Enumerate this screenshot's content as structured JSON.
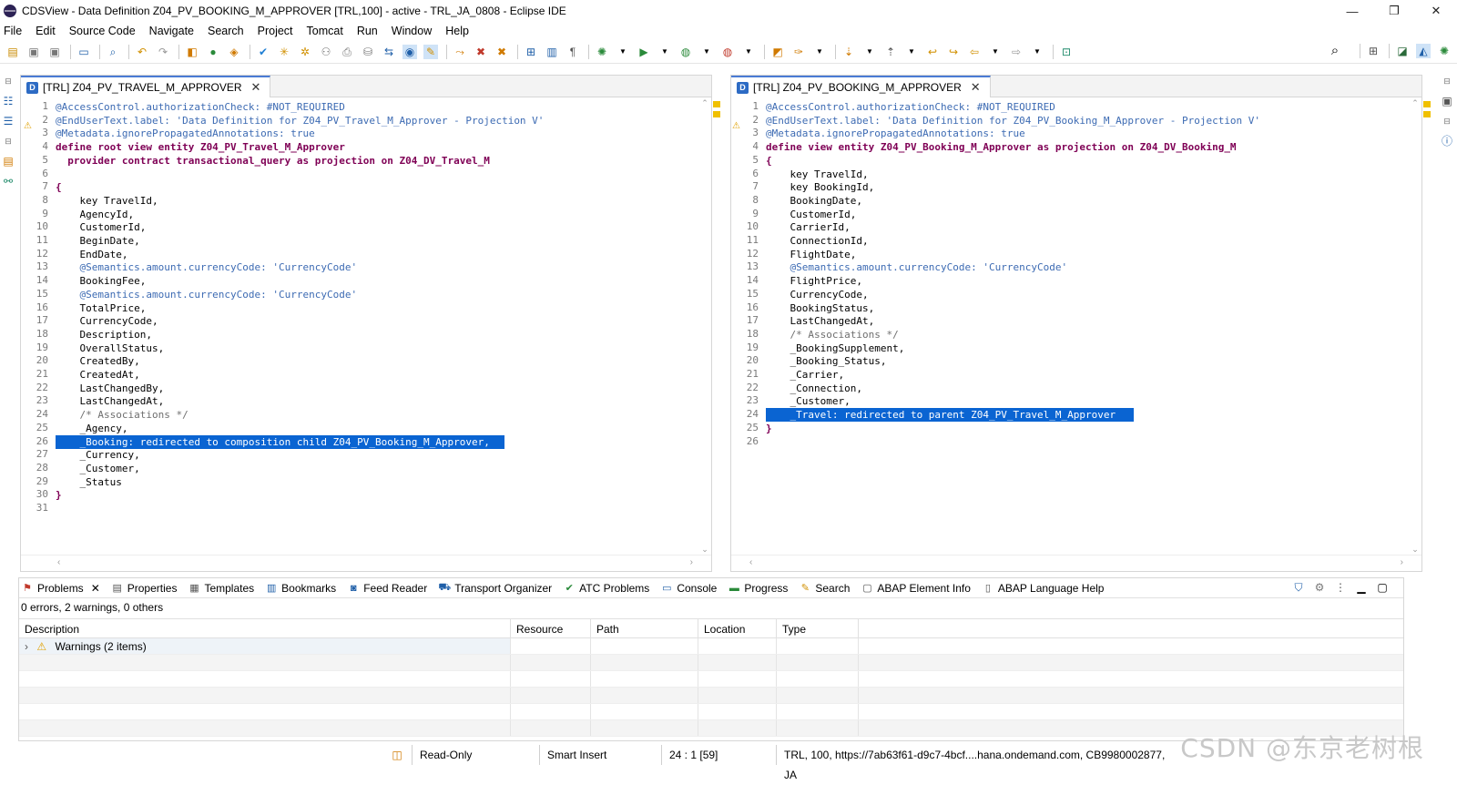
{
  "window": {
    "title": "CDSView - Data Definition Z04_PV_BOOKING_M_APPROVER [TRL,100] - active - TRL_JA_0808 - Eclipse IDE"
  },
  "menu": [
    "File",
    "Edit",
    "Source Code",
    "Navigate",
    "Search",
    "Project",
    "Tomcat",
    "Run",
    "Window",
    "Help"
  ],
  "left_editor": {
    "tab_label": "[TRL] Z04_PV_TRAVEL_M_APPROVER",
    "lines": [
      {
        "n": "1",
        "t": "@AccessControl.authorizationCheck: #NOT_REQUIRED",
        "k": "ann"
      },
      {
        "n": "2",
        "t": "@EndUserText.label: 'Data Definition for Z04_PV_Travel_M_Approver - Projection V'",
        "k": "ann"
      },
      {
        "n": "3",
        "t": "@Metadata.ignorePropagatedAnnotations: true",
        "k": "ann"
      },
      {
        "n": "4",
        "t": "define root view entity Z04_PV_Travel_M_Approver",
        "k": "kw"
      },
      {
        "n": "5",
        "t": "  provider contract transactional_query as projection on Z04_DV_Travel_M",
        "k": "kw"
      },
      {
        "n": "6",
        "t": "",
        "k": ""
      },
      {
        "n": "7",
        "t": "{",
        "k": "kw"
      },
      {
        "n": "8",
        "t": "    key TravelId,",
        "k": ""
      },
      {
        "n": "9",
        "t": "    AgencyId,",
        "k": ""
      },
      {
        "n": "10",
        "t": "    CustomerId,",
        "k": ""
      },
      {
        "n": "11",
        "t": "    BeginDate,",
        "k": ""
      },
      {
        "n": "12",
        "t": "    EndDate,",
        "k": ""
      },
      {
        "n": "13",
        "t": "    @Semantics.amount.currencyCode: 'CurrencyCode'",
        "k": "ann"
      },
      {
        "n": "14",
        "t": "    BookingFee,",
        "k": ""
      },
      {
        "n": "15",
        "t": "    @Semantics.amount.currencyCode: 'CurrencyCode'",
        "k": "ann"
      },
      {
        "n": "16",
        "t": "    TotalPrice,",
        "k": ""
      },
      {
        "n": "17",
        "t": "    CurrencyCode,",
        "k": ""
      },
      {
        "n": "18",
        "t": "    Description,",
        "k": ""
      },
      {
        "n": "19",
        "t": "    OverallStatus,",
        "k": ""
      },
      {
        "n": "20",
        "t": "    CreatedBy,",
        "k": ""
      },
      {
        "n": "21",
        "t": "    CreatedAt,",
        "k": ""
      },
      {
        "n": "22",
        "t": "    LastChangedBy,",
        "k": ""
      },
      {
        "n": "23",
        "t": "    LastChangedAt,",
        "k": ""
      },
      {
        "n": "24",
        "t": "    /* Associations */",
        "k": "cm"
      },
      {
        "n": "25",
        "t": "    _Agency,",
        "k": ""
      },
      {
        "n": "26",
        "t": "    _Booking: redirected to composition child Z04_PV_Booking_M_Approver,",
        "k": "hl"
      },
      {
        "n": "27",
        "t": "    _Currency,",
        "k": ""
      },
      {
        "n": "28",
        "t": "    _Customer,",
        "k": ""
      },
      {
        "n": "29",
        "t": "    _Status",
        "k": ""
      },
      {
        "n": "30",
        "t": "}",
        "k": "kw"
      },
      {
        "n": "31",
        "t": "",
        "k": ""
      }
    ]
  },
  "right_editor": {
    "tab_label": "[TRL] Z04_PV_BOOKING_M_APPROVER",
    "lines": [
      {
        "n": "1",
        "t": "@AccessControl.authorizationCheck: #NOT_REQUIRED",
        "k": "ann"
      },
      {
        "n": "2",
        "t": "@EndUserText.label: 'Data Definition for Z04_PV_Booking_M_Approver - Projection V'",
        "k": "ann"
      },
      {
        "n": "3",
        "t": "@Metadata.ignorePropagatedAnnotations: true",
        "k": "ann"
      },
      {
        "n": "4",
        "t": "define view entity Z04_PV_Booking_M_Approver as projection on Z04_DV_Booking_M",
        "k": "kw"
      },
      {
        "n": "5",
        "t": "{",
        "k": "kw"
      },
      {
        "n": "6",
        "t": "    key TravelId,",
        "k": ""
      },
      {
        "n": "7",
        "t": "    key BookingId,",
        "k": ""
      },
      {
        "n": "8",
        "t": "    BookingDate,",
        "k": ""
      },
      {
        "n": "9",
        "t": "    CustomerId,",
        "k": ""
      },
      {
        "n": "10",
        "t": "    CarrierId,",
        "k": ""
      },
      {
        "n": "11",
        "t": "    ConnectionId,",
        "k": ""
      },
      {
        "n": "12",
        "t": "    FlightDate,",
        "k": ""
      },
      {
        "n": "13",
        "t": "    @Semantics.amount.currencyCode: 'CurrencyCode'",
        "k": "ann"
      },
      {
        "n": "14",
        "t": "    FlightPrice,",
        "k": ""
      },
      {
        "n": "15",
        "t": "    CurrencyCode,",
        "k": ""
      },
      {
        "n": "16",
        "t": "    BookingStatus,",
        "k": ""
      },
      {
        "n": "17",
        "t": "    LastChangedAt,",
        "k": ""
      },
      {
        "n": "18",
        "t": "    /* Associations */",
        "k": "cm"
      },
      {
        "n": "19",
        "t": "    _BookingSupplement,",
        "k": ""
      },
      {
        "n": "20",
        "t": "    _Booking_Status,",
        "k": ""
      },
      {
        "n": "21",
        "t": "    _Carrier,",
        "k": ""
      },
      {
        "n": "22",
        "t": "    _Connection,",
        "k": ""
      },
      {
        "n": "23",
        "t": "    _Customer,",
        "k": ""
      },
      {
        "n": "24",
        "t": "    _Travel: redirected to parent Z04_PV_Travel_M_Approver ",
        "k": "hl"
      },
      {
        "n": "25",
        "t": "}",
        "k": "kw"
      },
      {
        "n": "26",
        "t": "",
        "k": ""
      }
    ]
  },
  "bottom_panel": {
    "tabs": [
      "Problems",
      "Properties",
      "Templates",
      "Bookmarks",
      "Feed Reader",
      "Transport Organizer",
      "ATC Problems",
      "Console",
      "Progress",
      "Search",
      "ABAP Element Info",
      "ABAP Language Help"
    ],
    "summary": "0 errors, 2 warnings, 0 others",
    "columns": [
      "Description",
      "Resource",
      "Path",
      "Location",
      "Type"
    ],
    "warnings_row": "Warnings (2 items)"
  },
  "status_bar": {
    "mode": "Read-Only",
    "insert": "Smart Insert",
    "position": "24 : 1 [59]",
    "connection": "TRL, 100, https://7ab63f61-d9c7-4bcf....hana.ondemand.com, CB9980002877, JA"
  },
  "watermark": "CSDN @东京老树根",
  "colors": {
    "accent": "#0a64d2",
    "annotation": "#3d6bb3",
    "keyword": "#7f0055"
  }
}
